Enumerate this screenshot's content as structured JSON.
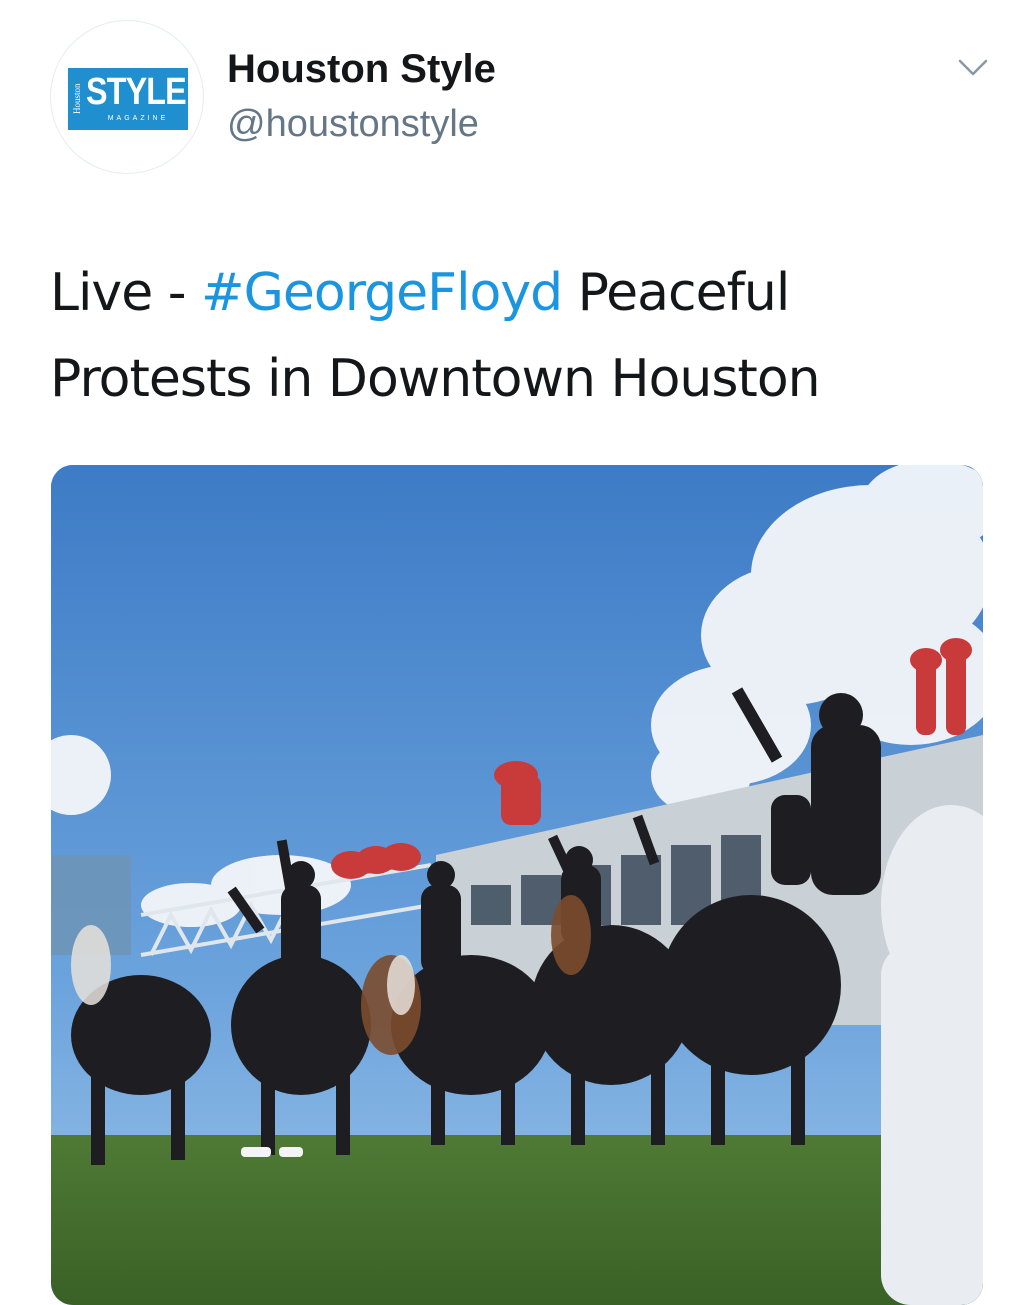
{
  "account": {
    "display_name": "Houston Style",
    "handle": "@houstonstyle",
    "avatar": {
      "logo_main": "STYLE",
      "logo_side": "Houston",
      "logo_sub": "MAGAZINE",
      "brand_color": "#1f8fcf"
    }
  },
  "menu": {
    "icon": "chevron-down-icon"
  },
  "tweet": {
    "text_prefix": "Live - ",
    "hashtag": "#GeorgeFloyd",
    "text_suffix": " Peaceful Protests in Downtown Houston",
    "hashtag_color": "#1b95e0"
  },
  "media": {
    "type": "video-still",
    "description_icon": "photo"
  }
}
